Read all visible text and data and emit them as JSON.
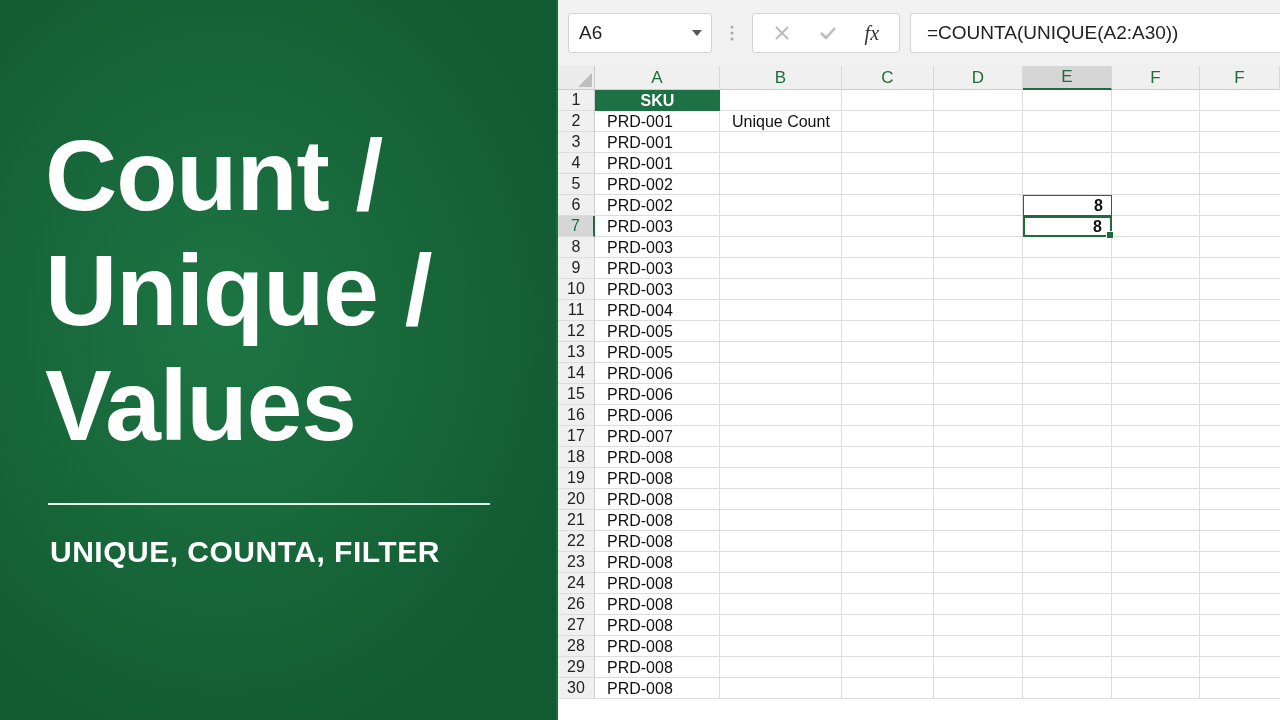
{
  "banner": {
    "title_lines": [
      "Count /",
      "Unique /",
      "Values"
    ],
    "subtitle": "UNIQUE, COUNTA, FILTER"
  },
  "formula_bar": {
    "name_box": "A6",
    "function_label": "fx",
    "formula": "=COUNTA(UNIQUE(A2:A30))"
  },
  "columns": [
    {
      "label": "A",
      "selected": false
    },
    {
      "label": "B",
      "selected": false
    },
    {
      "label": "C",
      "selected": false
    },
    {
      "label": "D",
      "selected": false
    },
    {
      "label": "E",
      "selected": true
    },
    {
      "label": "F",
      "selected": false
    },
    {
      "label": "F",
      "selected": false
    }
  ],
  "rows": [
    {
      "number": "1",
      "selected": false,
      "column_a": {
        "text": "SKU",
        "kind": "header"
      }
    },
    {
      "number": "2",
      "selected": false,
      "column_a": {
        "text": "PRD-001"
      },
      "column_b": {
        "text": "Unique Count"
      }
    },
    {
      "number": "3",
      "selected": false,
      "column_a": {
        "text": "PRD-001"
      }
    },
    {
      "number": "4",
      "selected": false,
      "column_a": {
        "text": "PRD-001"
      }
    },
    {
      "number": "5",
      "selected": false,
      "column_a": {
        "text": "PRD-002"
      }
    },
    {
      "number": "6",
      "selected": false,
      "column_a": {
        "text": "PRD-002"
      },
      "column_e": {
        "text": "8",
        "outlined": true
      }
    },
    {
      "number": "7",
      "selected": true,
      "column_a": {
        "text": "PRD-003"
      },
      "column_e": {
        "text": "8"
      }
    },
    {
      "number": "8",
      "selected": false,
      "column_a": {
        "text": "PRD-003"
      }
    },
    {
      "number": "9",
      "selected": false,
      "column_a": {
        "text": "PRD-003"
      }
    },
    {
      "number": "10",
      "selected": false,
      "column_a": {
        "text": "PRD-003"
      }
    },
    {
      "number": "11",
      "selected": false,
      "column_a": {
        "text": "PRD-004"
      }
    },
    {
      "number": "12",
      "selected": false,
      "column_a": {
        "text": "PRD-005"
      }
    },
    {
      "number": "13",
      "selected": false,
      "column_a": {
        "text": "PRD-005"
      }
    },
    {
      "number": "14",
      "selected": false,
      "column_a": {
        "text": "PRD-006"
      }
    },
    {
      "number": "15",
      "selected": false,
      "column_a": {
        "text": "PRD-006"
      }
    },
    {
      "number": "16",
      "selected": false,
      "column_a": {
        "text": "PRD-006"
      }
    },
    {
      "number": "17",
      "selected": false,
      "column_a": {
        "text": "PRD-007"
      }
    },
    {
      "number": "18",
      "selected": false,
      "column_a": {
        "text": "PRD-008"
      }
    },
    {
      "number": "19",
      "selected": false,
      "column_a": {
        "text": "PRD-008"
      }
    },
    {
      "number": "20",
      "selected": false,
      "column_a": {
        "text": "PRD-008"
      }
    },
    {
      "number": "21",
      "selected": false,
      "column_a": {
        "text": "PRD-008"
      }
    },
    {
      "number": "22",
      "selected": false,
      "column_a": {
        "text": "PRD-008"
      }
    },
    {
      "number": "23",
      "selected": false,
      "column_a": {
        "text": "PRD-008"
      }
    },
    {
      "number": "24",
      "selected": false,
      "column_a": {
        "text": "PRD-008"
      }
    },
    {
      "number": "26",
      "selected": false,
      "column_a": {
        "text": "PRD-008"
      }
    },
    {
      "number": "27",
      "selected": false,
      "column_a": {
        "text": "PRD-008"
      }
    },
    {
      "number": "28",
      "selected": false,
      "column_a": {
        "text": "PRD-008"
      }
    },
    {
      "number": "29",
      "selected": false,
      "column_a": {
        "text": "PRD-008"
      }
    },
    {
      "number": "30",
      "selected": false,
      "column_a": {
        "text": "PRD-008"
      }
    }
  ]
}
